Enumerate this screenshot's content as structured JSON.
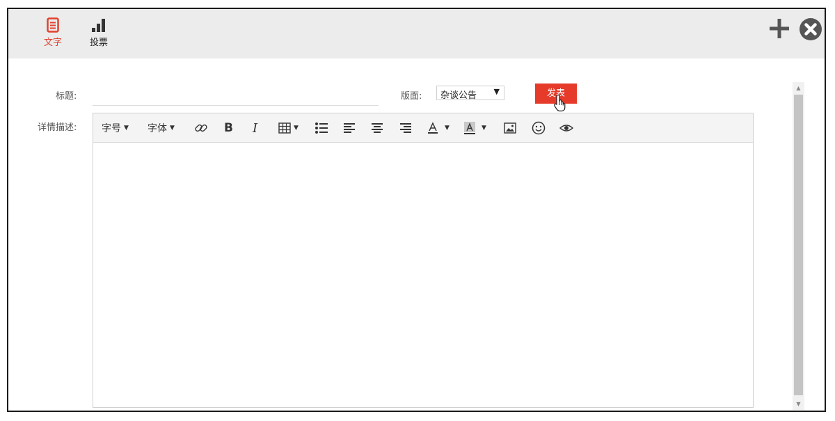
{
  "tabs": {
    "text": {
      "label": "文字",
      "icon": "document-icon",
      "active": true
    },
    "vote": {
      "label": "投票",
      "icon": "bar-chart-icon"
    }
  },
  "header_actions": {
    "add_icon": "plus-icon",
    "close_icon": "close-circle-icon"
  },
  "form": {
    "title_label": "标题:",
    "title_value": "",
    "board_label": "版面:",
    "board_selected": "杂谈公告",
    "publish_label": "发表",
    "desc_label": "详情描述:"
  },
  "toolbar": {
    "font_size_label": "字号",
    "font_family_label": "字体",
    "bold_label": "B",
    "italic_label": "I"
  },
  "colors": {
    "accent": "#e63b2a",
    "topbar_bg": "#ececec"
  }
}
